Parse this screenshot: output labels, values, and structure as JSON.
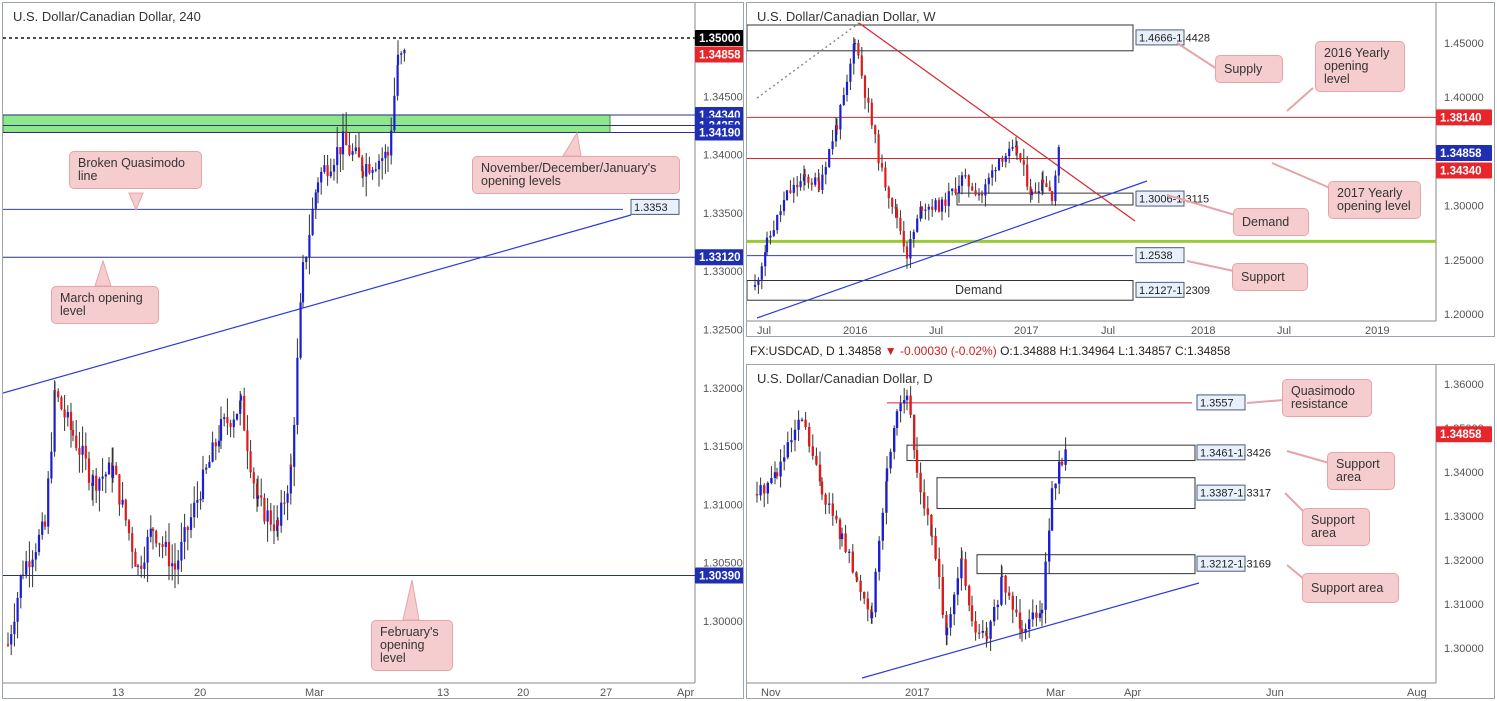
{
  "colors": {
    "up": "#1a1fd6",
    "down": "#e01b1b",
    "red_line": "#d9262e",
    "blue_line": "#2c3bd9",
    "green_zone": "#8ee88a",
    "green_line": "#9cc936",
    "price_tag": "#e6262b",
    "level_tag": "#1f2fb3"
  },
  "chart_data": [
    {
      "type": "candlestick",
      "title": "U.S. Dollar/Canadian Dollar, 240",
      "x_tick_labels": [
        "13",
        "20",
        "Mar",
        "13",
        "20",
        "27",
        "Apr"
      ],
      "y_tick_labels": [
        "1.34500",
        "1.34000",
        "1.33500",
        "1.33000",
        "1.32500",
        "1.32000",
        "1.31500",
        "1.31000",
        "1.30500",
        "1.30000"
      ],
      "ylim": [
        1.296,
        1.3525
      ],
      "levels": [
        {
          "label": "1.35000",
          "value": 1.35,
          "style": "dotted-black"
        },
        {
          "label": "1.34340",
          "value": 1.3434,
          "style": "blue"
        },
        {
          "label": "1.34250",
          "value": 1.3425,
          "style": "blue"
        },
        {
          "label": "1.34190",
          "value": 1.3419,
          "style": "blue"
        },
        {
          "label": "1.33120",
          "value": 1.3312,
          "style": "blue"
        },
        {
          "label": "1.30390",
          "value": 1.3039,
          "style": "blue"
        }
      ],
      "current_price": "1.34858",
      "level_labels": {
        "quasimodo": "1.3353"
      },
      "annotations": [
        "Broken Quasimodo line",
        "November/December/January's opening levels",
        "March opening level",
        "February's opening level"
      ]
    },
    {
      "type": "candlestick",
      "title": "U.S. Dollar/Canadian Dollar, W",
      "x_tick_labels": [
        "Jul",
        "2016",
        "Jul",
        "2017",
        "Jul",
        "2018",
        "Jul",
        "2019"
      ],
      "y_tick_labels": [
        "1.45000",
        "1.40000",
        "1.35000",
        "1.30000",
        "1.25000",
        "1.20000"
      ],
      "ylim": [
        1.195,
        1.465
      ],
      "levels": [
        {
          "label": "1.38140",
          "value": 1.3814
        },
        {
          "label": "1.34340",
          "value": 1.3434
        },
        {
          "label": "1.2538",
          "value": 1.2538
        }
      ],
      "zones": [
        {
          "label": "1.4666-1.4428",
          "from": 1.4428,
          "to": 1.4666
        },
        {
          "label": "1.3006-1.3115",
          "from": 1.3006,
          "to": 1.3115
        },
        {
          "label": "1.2127-1.2309",
          "from": 1.2127,
          "to": 1.2309
        }
      ],
      "current_price": "1.34858",
      "annotations": [
        "Supply",
        "2016 Yearly opening level",
        "Demand",
        "2017 Yearly opening level",
        "Support"
      ]
    },
    {
      "type": "candlestick",
      "title": "U.S. Dollar/Canadian Dollar, D",
      "x_tick_labels": [
        "Nov",
        "2017",
        "Mar",
        "Apr",
        "Jun",
        "Aug"
      ],
      "y_tick_labels": [
        "1.36000",
        "1.35000",
        "1.34000",
        "1.33000",
        "1.32000",
        "1.31000",
        "1.30000"
      ],
      "ylim": [
        1.294,
        1.363
      ],
      "levels": [
        {
          "label": "1.3557",
          "value": 1.3557
        }
      ],
      "zones": [
        {
          "label": "1.3461-1.3426",
          "from": 1.3426,
          "to": 1.3461
        },
        {
          "label": "1.3387-1.3317",
          "from": 1.3317,
          "to": 1.3387
        },
        {
          "label": "1.3212-1.3169",
          "from": 1.3169,
          "to": 1.3212
        }
      ],
      "current_price": "1.34858",
      "annotations": [
        "Quasimodo resistance",
        "Support area",
        "Support area",
        "Support area"
      ]
    }
  ],
  "ohlc": {
    "symbol": "FX:USDCAD, D",
    "price": "1.34858",
    "arrow": "▼",
    "change": "-0.00030 (-0.02%)",
    "o": "O:1.34888",
    "h": "H:1.34964",
    "l": "L:1.34857",
    "c": "C:1.34858"
  },
  "callouts": {
    "broken_qm": "Broken Quasimodo line",
    "ndj": "November/December/January's opening levels",
    "march": "March opening level",
    "february": "February's opening level",
    "supply": "Supply",
    "yo2016": "2016 Yearly opening level",
    "demand_callout": "Demand",
    "yo2017": "2017 Yearly opening level",
    "support": "Support",
    "demand_zone": "Demand",
    "qm_res": "Quasimodo resistance",
    "sa1": "Support area",
    "sa2": "Support area",
    "sa3": "Support area"
  }
}
